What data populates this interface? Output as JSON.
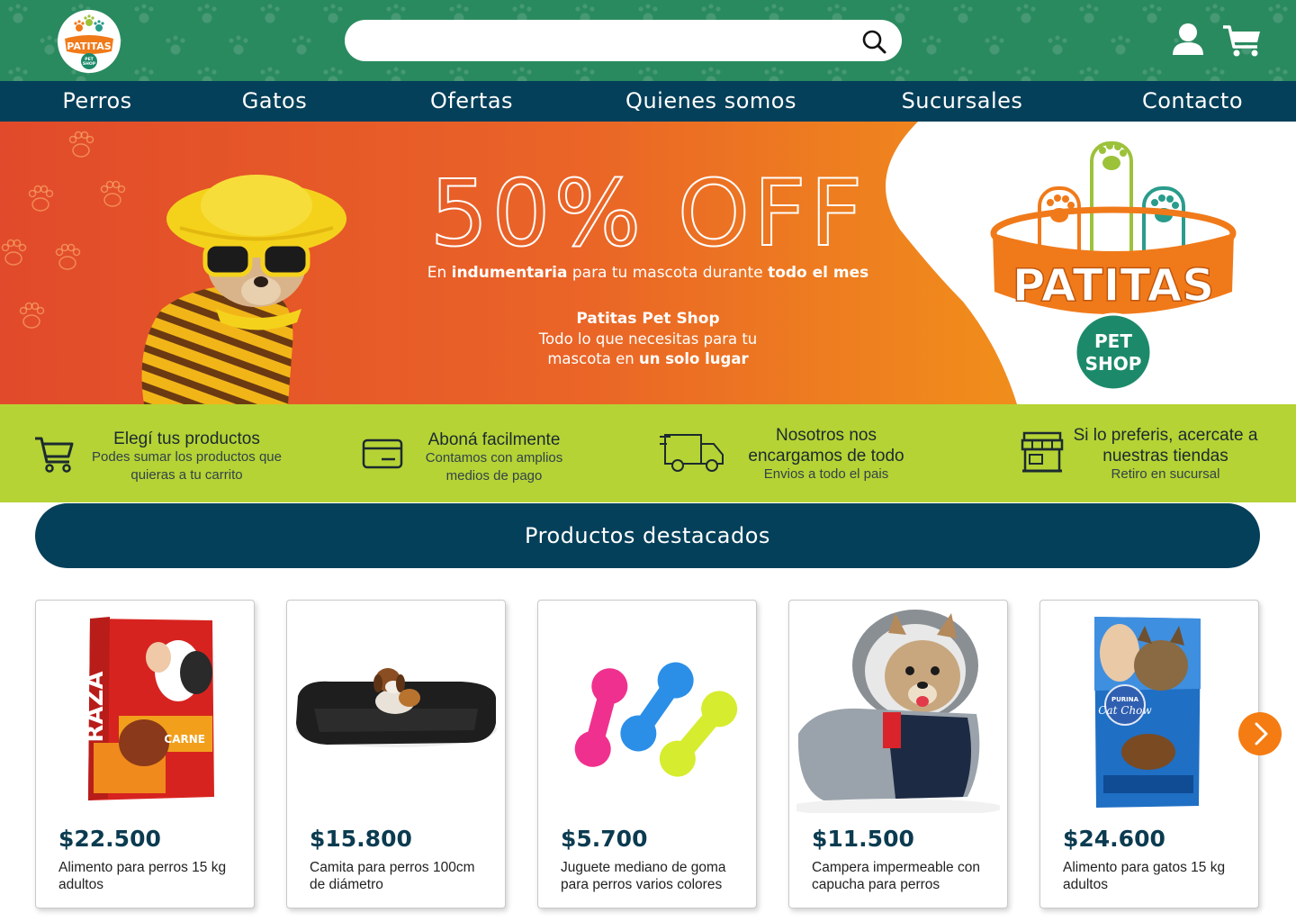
{
  "header": {
    "search": {
      "placeholder": "",
      "value": ""
    },
    "logo_text": "PATITAS",
    "logo_sub": "PET SHOP"
  },
  "nav": {
    "items": [
      "Perros",
      "Gatos",
      "Ofertas",
      "Quienes somos",
      "Sucursales",
      "Contacto"
    ]
  },
  "hero": {
    "headline": "50% OFF",
    "line1_pre": "En ",
    "line1_b1": "indumentaria",
    "line1_mid": " para tu mascota durante ",
    "line1_b2": "todo el mes",
    "shop_name": "Patitas Pet Shop",
    "tag_pre": "Todo lo que necesitas para tu",
    "tag_mid": "mascota en ",
    "tag_bold": "un solo lugar",
    "logo_text": "PATITAS",
    "logo_sub1": "PET",
    "logo_sub2": "SHOP"
  },
  "benefits": [
    {
      "title": "Elegí tus productos",
      "sub": "Podes sumar los productos que quieras a tu carrito",
      "icon": "cart-icon"
    },
    {
      "title": "Aboná facilmente",
      "sub": "Contamos con amplios medios de pago",
      "icon": "credit-card-icon"
    },
    {
      "title": "Nosotros nos encargamos de todo",
      "sub": "Envios a todo el pais",
      "icon": "truck-icon"
    },
    {
      "title": "Si lo preferis, acercate a nuestras tiendas",
      "sub": "Retiro en sucursal",
      "icon": "store-icon"
    }
  ],
  "featured_title": "Productos destacados",
  "products": [
    {
      "price": "$22.500",
      "desc": "Alimento para perros 15 kg adultos",
      "brand": "RAZA",
      "label": "CARNE"
    },
    {
      "price": "$15.800",
      "desc": "Camita para perros 100cm de diámetro"
    },
    {
      "price": "$5.700",
      "desc": "Juguete mediano de goma para perros varios colores"
    },
    {
      "price": "$11.500",
      "desc": "Campera impermeable con capucha para perros"
    },
    {
      "price": "$24.600",
      "desc": "Alimento para gatos 15 kg adultos",
      "brand": "Cat Chow",
      "maker": "PURINA"
    }
  ],
  "colors": {
    "header_green": "#2a8a5f",
    "nav_blue": "#05405a",
    "benefits_lime": "#b5d334",
    "accent_orange": "#f57c12"
  }
}
